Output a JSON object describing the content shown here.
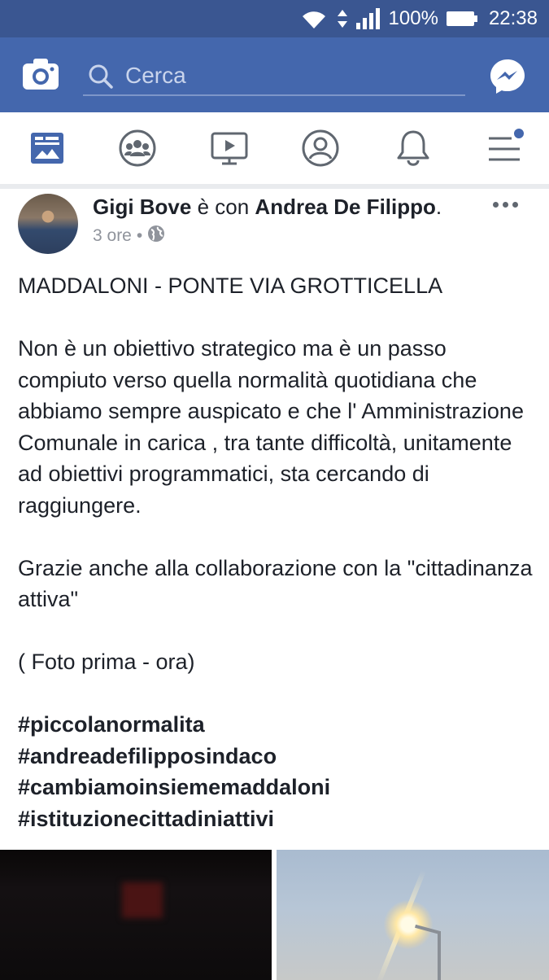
{
  "status_bar": {
    "battery": "100%",
    "time": "22:38"
  },
  "header": {
    "search_placeholder": "Cerca",
    "icons": [
      "camera-icon",
      "search-icon",
      "messenger-icon"
    ]
  },
  "nav": {
    "items": [
      "news-feed-icon",
      "groups-icon",
      "watch-icon",
      "profile-icon",
      "notifications-icon",
      "menu-icon"
    ],
    "accent_color": "#4467ad"
  },
  "post": {
    "author": "Gigi Bove",
    "with_text": " è con ",
    "tagged": "Andrea De Filippo",
    "period": ".",
    "time": "3 ore",
    "separator": "•",
    "title": "MADDALONI - PONTE VIA GROTTICELLA",
    "paragraph1": "Non è un obiettivo strategico ma è un passo compiuto verso quella normalità quotidiana che abbiamo sempre auspicato e che l' Amministrazione Comunale in carica  , tra tante difficoltà, unitamente ad obiettivi programmatici, sta cercando di raggiungere.",
    "paragraph2": "Grazie anche alla collaborazione con la \"cittadinanza attiva\"",
    "paragraph3": "( Foto prima - ora)",
    "hashtags": [
      "#piccolanormalita",
      "#andreadefilipposindaco",
      "#cambiamoinsiememaddaloni",
      "#istituzionecittadiniattivi"
    ]
  },
  "colors": {
    "status_bar": "#3a5691",
    "header": "#4467ad",
    "text": "#1d2129",
    "meta": "#90949c"
  }
}
